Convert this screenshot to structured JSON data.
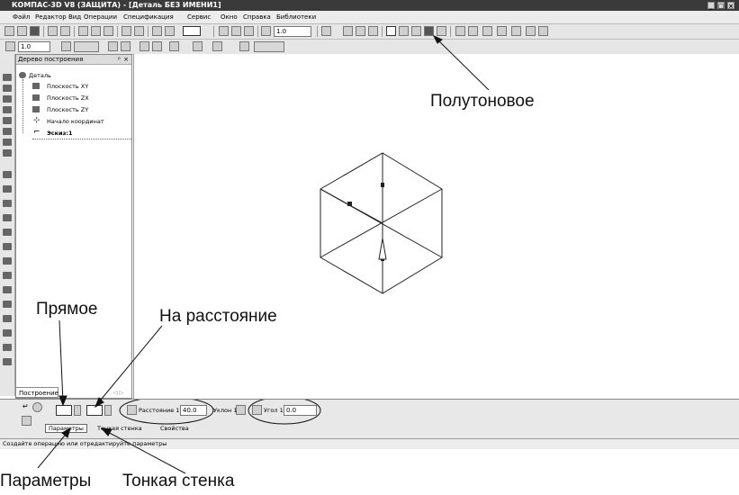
{
  "window": {
    "title": "КОМПАС-3D V8 (ЗАЩИТА) - [Деталь БЕЗ ИМЕНИ1]"
  },
  "menu": [
    "Файл",
    "Редактор",
    "Вид",
    "Операции",
    "Спецификация",
    "Сервис",
    "Окно",
    "Справка",
    "Библиотеки"
  ],
  "toolbar": {
    "zoom_value": "1.0",
    "step_value": "1.0"
  },
  "tree": {
    "title": "Дерево построения",
    "items": [
      "Деталь",
      "Плоскость XY",
      "Плоскость ZX",
      "Плоскость ZY",
      "Начало координат",
      "Эскиз:1"
    ],
    "tab_label": "Построение"
  },
  "props": {
    "distance_label": "Расстояние 1",
    "distance_value": "40.0",
    "slope_label": "Уклон 1",
    "angle_label": "Угол 1",
    "angle_value": "0.0",
    "tabs": [
      "Параметры",
      "Тонкая стенка",
      "Свойства"
    ]
  },
  "status": {
    "text": "Создайте операцию или отредактируйте параметры"
  },
  "annotations": {
    "halftone": "Полутоновое",
    "direct": "Прямое",
    "at_distance": "На расстояние",
    "params": "Параметры",
    "thin_wall": "Тонкая стенка"
  }
}
